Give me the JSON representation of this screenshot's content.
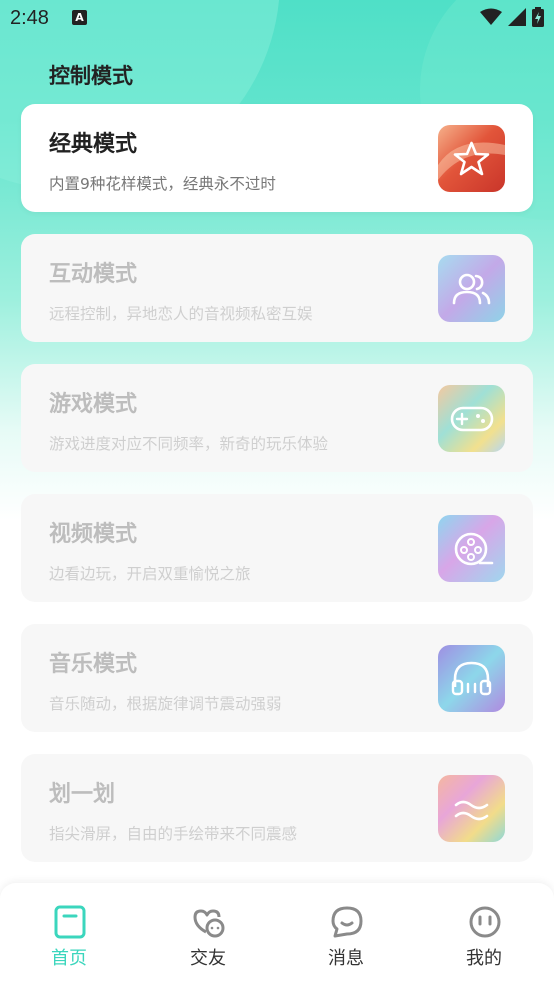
{
  "status_bar": {
    "time": "2:48",
    "notification_icon": "A"
  },
  "page": {
    "section_title": "控制模式"
  },
  "modes": [
    {
      "title": "经典模式",
      "desc": "内置9种花样模式，经典永不过时",
      "icon": "star-icon",
      "active": true
    },
    {
      "title": "互动模式",
      "desc": "远程控制，异地恋人的音视频私密互娱",
      "icon": "users-icon",
      "active": false
    },
    {
      "title": "游戏模式",
      "desc": "游戏进度对应不同频率，新奇的玩乐体验",
      "icon": "gamepad-icon",
      "active": false
    },
    {
      "title": "视频模式",
      "desc": "边看边玩，开启双重愉悦之旅",
      "icon": "film-reel-icon",
      "active": false
    },
    {
      "title": "音乐模式",
      "desc": "音乐随动，根据旋律调节震动强弱",
      "icon": "headphones-icon",
      "active": false
    },
    {
      "title": "划一划",
      "desc": "指尖滑屏，自由的手绘带来不同震感",
      "icon": "wave-icon",
      "active": false
    }
  ],
  "tabbar": {
    "tabs": [
      {
        "label": "首页",
        "icon": "home-icon",
        "active": true
      },
      {
        "label": "交友",
        "icon": "heart-chat-icon",
        "active": false
      },
      {
        "label": "消息",
        "icon": "message-icon",
        "active": false
      },
      {
        "label": "我的",
        "icon": "profile-icon",
        "active": false
      }
    ]
  },
  "colors": {
    "accent": "#3bd6bd",
    "header_gradient_top": "#4fe0c7",
    "card_bg": "#f7f7f7"
  }
}
